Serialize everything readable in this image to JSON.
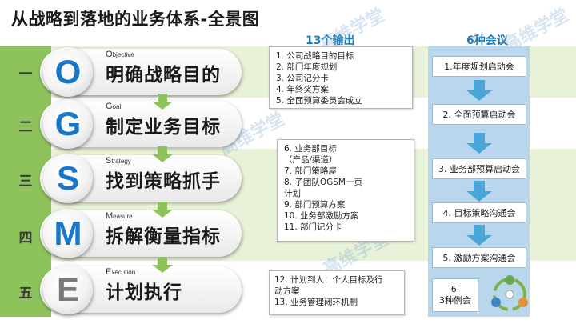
{
  "title": "从战略到落地的业务体系-全景图",
  "outputs_header": "13个输出",
  "meetings_header": "6种会议",
  "stages": [
    {
      "num": "一",
      "letter": "O",
      "english": "Objective",
      "chinese": "明确战略目的"
    },
    {
      "num": "二",
      "letter": "G",
      "english": "Goal",
      "chinese": "制定业务目标"
    },
    {
      "num": "三",
      "letter": "S",
      "english": "Strategy",
      "chinese": "找到策略抓手"
    },
    {
      "num": "四",
      "letter": "M",
      "english": "Measure",
      "chinese": "拆解衡量指标"
    },
    {
      "num": "五",
      "letter": "E",
      "english": "Execution",
      "chinese": "计划执行"
    }
  ],
  "outputs_group1": [
    "1.   公司战略目的目标",
    "2.   部门年度规划",
    "3.   公司记分卡",
    "4.   年终奖方案",
    "5.   全面预算委员会成立"
  ],
  "outputs_group2": [
    "6.   业务部目标",
    "      （产品/渠道）",
    "7.   部门策略屋",
    "8.   子团队OGSM一页",
    "      计划",
    "9.    部门预算方案",
    "10.  业务部激励方案",
    "11.  部门记分卡"
  ],
  "outputs_group3": [
    "12. 计划到人：个人目标及行",
    "      动方案",
    "13. 业务管理闭环机制"
  ],
  "meetings": [
    "1.年度规划启动会",
    "2. 全面预算启动会",
    "3. 业务部预算启动会",
    "4. 目标策略沟通会",
    "5. 激励方案沟通会"
  ],
  "meeting6": {
    "num": "6.",
    "label": "3种例会"
  },
  "watermark": "高维学堂",
  "colors": {
    "accent_green": "#8dc35a",
    "band_light": "#e8f2d8",
    "letter_blue": "#1876c9",
    "header_blue": "#1f7bb6",
    "meeting_col": "#b9d7ec",
    "arrow_blue": "#4aa6d8"
  }
}
